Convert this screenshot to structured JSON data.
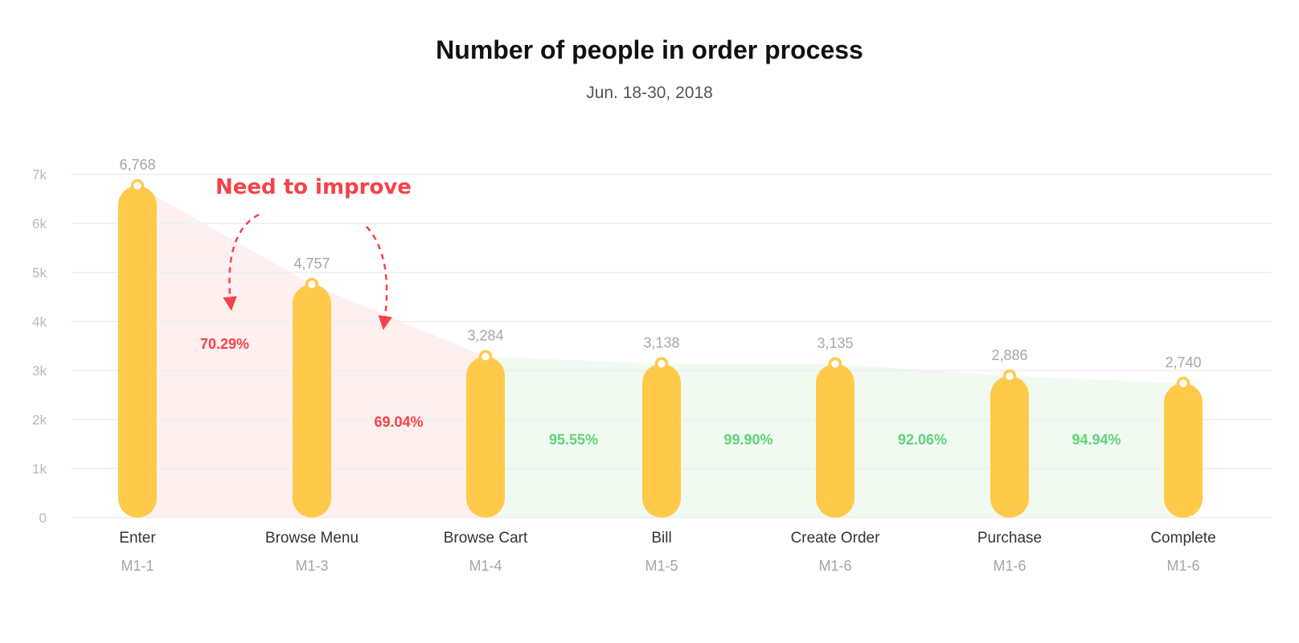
{
  "chart_data": {
    "type": "bar",
    "title": "Number of people in order process",
    "subtitle": "Jun. 18-30, 2018",
    "categories": [
      "Enter",
      "Browse Menu",
      "Browse Cart",
      "Bill",
      "Create Order",
      "Purchase",
      "Complete"
    ],
    "sublabels": [
      "M1-1",
      "M1-3",
      "M1-4",
      "M1-5",
      "M1-6",
      "M1-6",
      "M1-6"
    ],
    "values": [
      6768,
      4757,
      3284,
      3138,
      3135,
      2886,
      2740
    ],
    "value_labels": [
      "6,768",
      "4,757",
      "3,284",
      "3,138",
      "3,135",
      "2,886",
      "2,740"
    ],
    "yticks": [
      0,
      1000,
      2000,
      3000,
      4000,
      5000,
      6000,
      7000
    ],
    "ytick_labels": [
      "0",
      "1k",
      "2k",
      "3k",
      "4k",
      "5k",
      "6k",
      "7k"
    ],
    "ylim": [
      0,
      7000
    ],
    "grid": true,
    "conversion_rates": [
      {
        "label": "70.29%",
        "status": "bad"
      },
      {
        "label": "69.04%",
        "status": "bad"
      },
      {
        "label": "95.55%",
        "status": "good"
      },
      {
        "label": "99.90%",
        "status": "good"
      },
      {
        "label": "92.06%",
        "status": "good"
      },
      {
        "label": "94.94%",
        "status": "good"
      }
    ],
    "annotation": "Need to improve"
  },
  "colors": {
    "bar": "#ffc94a",
    "bad": "#f5424b",
    "good": "#5fd37a",
    "bad_fill": "#fff0f0",
    "good_fill": "#f0faf0",
    "grid": "#eeeeee"
  }
}
